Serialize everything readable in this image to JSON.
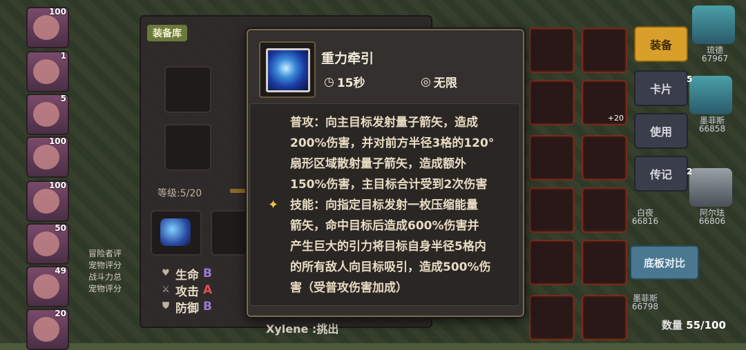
{
  "heroes_left": [
    {
      "level": "100"
    },
    {
      "level": "1"
    },
    {
      "level": "5"
    },
    {
      "level": "100"
    },
    {
      "level": "100"
    },
    {
      "level": "50"
    },
    {
      "level": "49"
    },
    {
      "level": "20"
    }
  ],
  "panel": {
    "tab_label": "装备库",
    "level_text": "等级:5/20",
    "stats": [
      {
        "icon": "heart-icon",
        "name": "生命",
        "grade": "B"
      },
      {
        "icon": "sword-icon",
        "name": "攻击",
        "grade": "A"
      },
      {
        "icon": "shield-icon",
        "name": "防御",
        "grade": "B"
      }
    ],
    "left_info": [
      "冒险者评",
      "宠物评分",
      "战斗力总",
      "宠物评分"
    ]
  },
  "tooltip": {
    "title": "重力牵引",
    "cooldown": "15秒",
    "range": "无限",
    "description": "普攻：向主目标发射量子箭矢，造成\n200%伤害，并对前方半径3格的120°\n扇形区域散射量子箭矢，造成额外\n150%伤害，主目标合计受到2次伤害\n技能：向指定目标发射一枚压缩能量\n箭矢，命中目标后造成600%伤害并\n产生巨大的引力将目标自身半径5格内\n的所有敌人向目标吸引，造成500%伤\n害（受普攻伤害加成）"
  },
  "grid_items": [
    {
      "plus": ""
    },
    {
      "plus": ""
    },
    {
      "plus": ""
    },
    {
      "plus": "+20"
    },
    {
      "plus": ""
    },
    {
      "plus": ""
    },
    {
      "plus": ""
    },
    {
      "plus": ""
    },
    {
      "plus": ""
    },
    {
      "plus": ""
    },
    {
      "plus": ""
    },
    {
      "plus": ""
    }
  ],
  "side_buttons": [
    "装备",
    "卡片",
    "使用",
    "传记"
  ],
  "compare_button": "底板对比",
  "heroes_right": [
    {
      "name": "琉德",
      "power": "67967",
      "level": ""
    },
    {
      "name": "墨菲斯",
      "power": "66858",
      "level": "5"
    },
    {
      "name": "阿尔珐",
      "power": "66806",
      "level": "2"
    },
    {
      "name": "白夜",
      "power": "66816",
      "level": ""
    },
    {
      "name": "墨菲斯",
      "power": "66798",
      "level": ""
    }
  ],
  "count_label": "数量",
  "count_value": "55/100",
  "bottom_text": "Xylene :挑出"
}
